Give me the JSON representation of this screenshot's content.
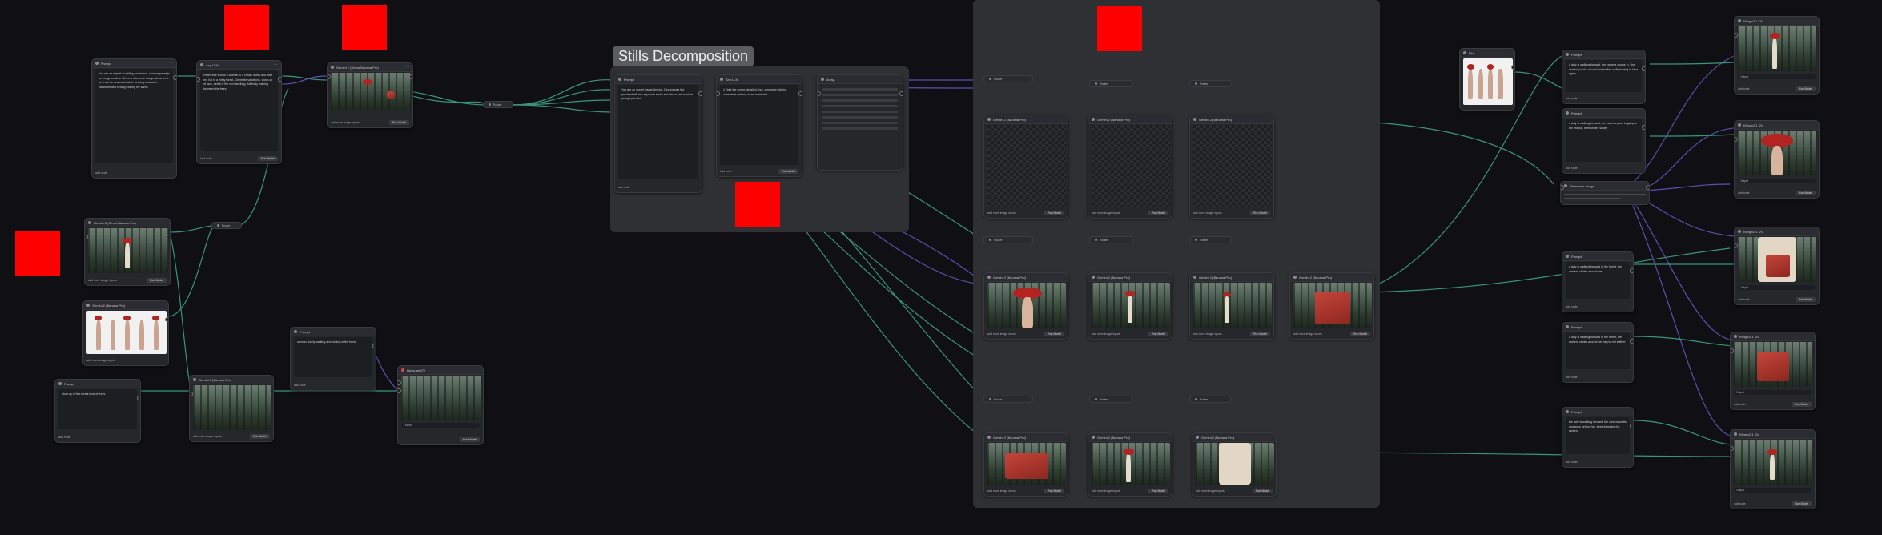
{
  "canvas": {
    "background": "#101014",
    "wire_color": "#3fae8c",
    "wire_color_alt": "#6a5acd"
  },
  "group": {
    "title": "Stills Decomposition"
  },
  "nodes": {
    "prompt": "Prompt",
    "any_llm": "Any LLM",
    "gemini": "Gemini 2 (Gems Banana Pro)",
    "gemini_short": "Gemini 2 (Banana Pro)",
    "router": "Router",
    "array": "Array",
    "list": "List",
    "reference_image": "Reference Image",
    "kling": "Kling v2.1 I2V",
    "hunyuan": "Hunyuan I2V",
    "file": "File",
    "run_model": "Run Model",
    "add_image": "add more image inputs",
    "add_node": "add node",
    "image_label": "image",
    "output_label": "Output"
  },
  "texts": {
    "system_prompt": "You are an expert at writing consistent, concise prompts for image models. Given a reference image, describe it so it can be recreated while keeping character, wardrobe and setting exactly the same.",
    "structure": "Main positive:",
    "llm_output": "Reference shows a woman in a cream dress and wide red hat in a misty forest. Generate variations: close-up of face, detail of the red handbag, full body walking between the trees.",
    "decomp_prompt": "You are an expert visual director. Decompose the provided still into separate shots and return one concise prompt per shot.",
    "decomp_list": "1 Take the scene: detailed shot, cinematic lighting, consistent subject, same wardrobe",
    "forest_prompt": "close up of the forest floor of trees",
    "walking_prompt": "woman slowly walking and turning in the forest",
    "vid1": "a lady is walking forward, the camera zooms in, she carefully looks around and smiles while turning to face again",
    "vid2": "a lady is walking forward, the camera pans to glimpse the red hat, then smiles slowly",
    "vid3": "a lady is walking forward in the forest, the camera circles around her",
    "vid4": "a lady is walking forward in the forest, the camera circles around her bag to red leather",
    "vid5": "the lady is walking forward, the camera orbits and goes behind her, trees following the camera"
  },
  "labels": {
    "red_note": "Note",
    "group_note": "Stills Decomposition"
  }
}
